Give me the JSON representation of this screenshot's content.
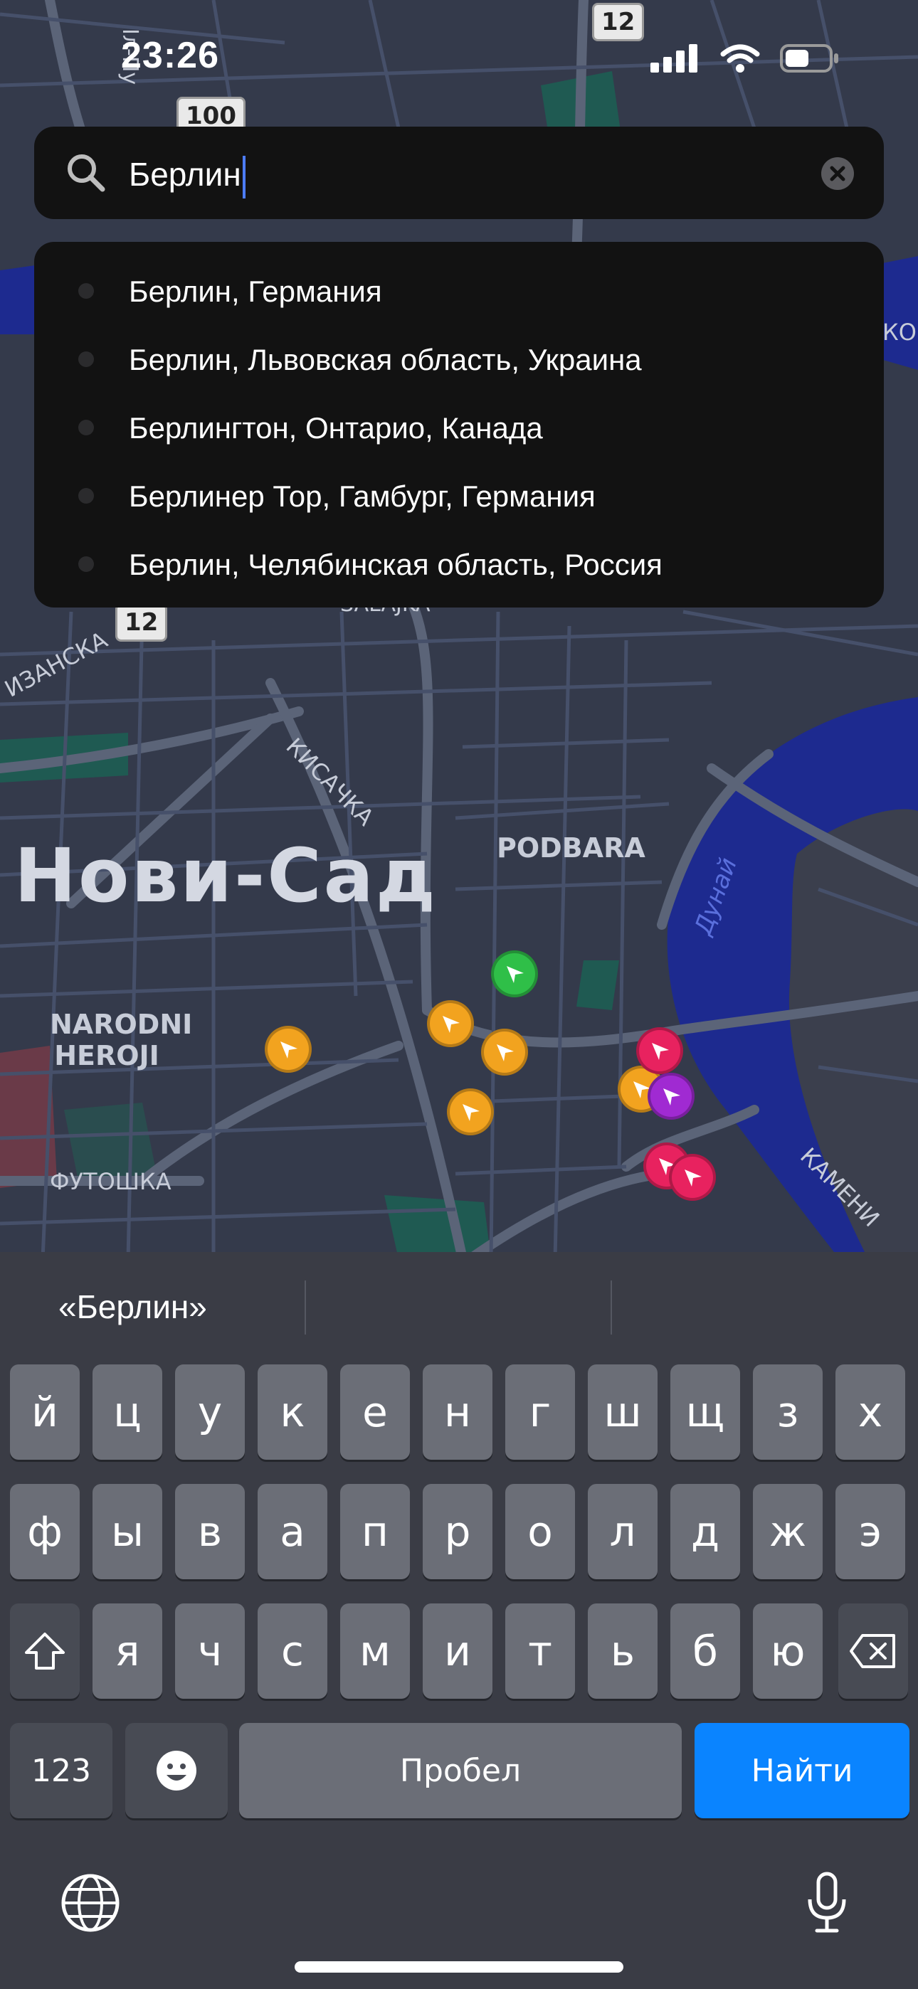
{
  "status": {
    "time": "23:26"
  },
  "map": {
    "city_label": "Нови-Сад",
    "districts": [
      "PODBARA",
      "NARODNI HEROJI"
    ],
    "street_labels": [
      "КИСАЧКА",
      "ФУТОШКА",
      "КАМЕНИ",
      "ИЗАНСКА",
      "SALAJKA",
      "КО",
      "Іл-Пу"
    ],
    "river_label": "Дунай",
    "road_shields": [
      "100",
      "12",
      "12",
      "12"
    ]
  },
  "search": {
    "query": "Берлин"
  },
  "suggestions": [
    "Берлин, Германия",
    "Берлин, Львовская область, Украина",
    "Берлингтон, Онтарио, Канада",
    "Берлинер Тор, Гамбург, Германия",
    "Берлин, Челябинская область, Россия"
  ],
  "markers": [
    {
      "color": "#2fbf48"
    },
    {
      "color": "#f2a31f"
    },
    {
      "color": "#f2a31f"
    },
    {
      "color": "#f2a31f"
    },
    {
      "color": "#f2a31f"
    },
    {
      "color": "#f2a31f"
    },
    {
      "color": "#e8225f"
    },
    {
      "color": "#e8225f"
    },
    {
      "color": "#a02ad2"
    },
    {
      "color": "#e8225f"
    }
  ],
  "keyboard": {
    "prediction": "«Берлин»",
    "row1": [
      "й",
      "ц",
      "у",
      "к",
      "е",
      "н",
      "г",
      "ш",
      "щ",
      "з",
      "х"
    ],
    "row2": [
      "ф",
      "ы",
      "в",
      "а",
      "п",
      "р",
      "о",
      "л",
      "д",
      "ж",
      "э"
    ],
    "row3": [
      "я",
      "ч",
      "с",
      "м",
      "и",
      "т",
      "ь",
      "б",
      "ю"
    ],
    "numbers_key": "123",
    "space_key": "Пробел",
    "go_key": "Найти"
  }
}
